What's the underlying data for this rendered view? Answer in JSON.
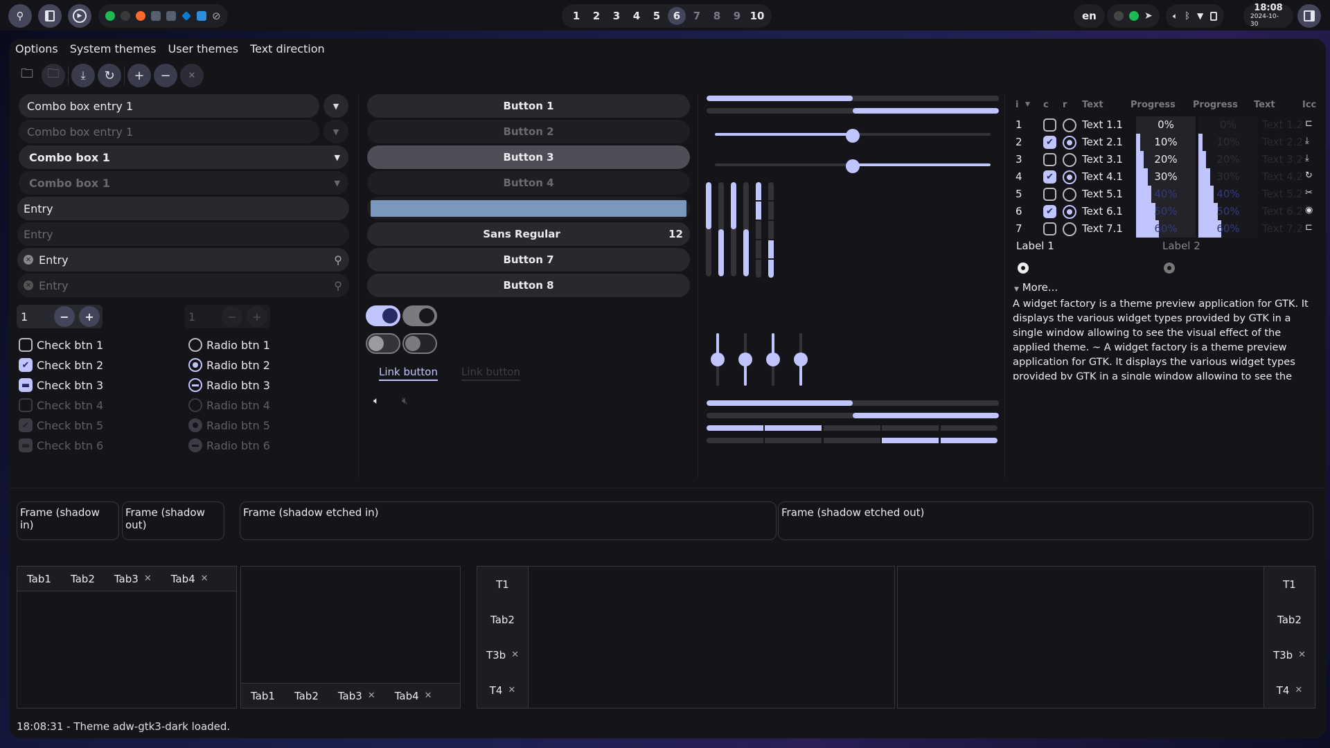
{
  "topbar": {
    "workspaces": [
      {
        "label": "1",
        "state": "normal"
      },
      {
        "label": "2",
        "state": "normal"
      },
      {
        "label": "3",
        "state": "normal"
      },
      {
        "label": "4",
        "state": "normal"
      },
      {
        "label": "5",
        "state": "normal"
      },
      {
        "label": "6",
        "state": "active"
      },
      {
        "label": "7",
        "state": "dim"
      },
      {
        "label": "8",
        "state": "dim"
      },
      {
        "label": "9",
        "state": "dim"
      },
      {
        "label": "10",
        "state": "normal"
      }
    ],
    "apps": [
      "spotify-icon",
      "obs-icon",
      "firefox-icon",
      "folder-icon",
      "folder-icon",
      "vscode-icon",
      "files-icon",
      "blocked-icon"
    ],
    "language": "en",
    "clock_time": "18:08",
    "clock_date": "2024-10-30"
  },
  "menu": [
    "Options",
    "System themes",
    "User themes",
    "Text direction"
  ],
  "col1": {
    "combo_entry": "Combo box entry 1",
    "combo_entry_disabled": "Combo box entry 1",
    "combo": "Combo box 1",
    "combo_disabled": "Combo box 1",
    "entry": "Entry",
    "entry_disabled": "Entry",
    "search_entry": "Entry",
    "search_entry_disabled": "Entry",
    "spin_value": "1",
    "spin_value_disabled": "1",
    "spin_minus": "−",
    "spin_plus": "+",
    "checks": [
      {
        "label": "Check btn 1",
        "state": "off"
      },
      {
        "label": "Check btn 2",
        "state": "on"
      },
      {
        "label": "Check btn 3",
        "state": "mixed"
      },
      {
        "label": "Check btn 4",
        "state": "dis"
      },
      {
        "label": "Check btn 5",
        "state": "dison"
      },
      {
        "label": "Check btn 6",
        "state": "dismix"
      }
    ],
    "radios": [
      {
        "label": "Radio btn 1",
        "state": "off"
      },
      {
        "label": "Radio btn 2",
        "state": "on"
      },
      {
        "label": "Radio btn 3",
        "state": "mix"
      },
      {
        "label": "Radio btn 4",
        "state": "dis"
      },
      {
        "label": "Radio btn 5",
        "state": "dison"
      },
      {
        "label": "Radio btn 6",
        "state": "dismix"
      }
    ]
  },
  "col2": {
    "buttons": [
      "Button 1",
      "Button 2",
      "Button 3",
      "Button 4"
    ],
    "font_button": "Sans Regular",
    "font_size": "12",
    "button7": "Button 7",
    "button8": "Button 8",
    "color_button": "#7a98bd",
    "link": "Link button",
    "link_disabled": "Link button"
  },
  "col3": {
    "hprogress": [
      0.5,
      0.5
    ],
    "hscale": [
      0.5,
      0.5
    ],
    "vprogress": [
      0.5,
      0.5,
      0.5,
      0.5
    ],
    "level_bars": [
      0.4,
      0.4
    ],
    "vscale": [
      0.5,
      0.5,
      0.5,
      0.5
    ],
    "hprogress2": [
      0.5,
      0.5
    ],
    "hlevel": [
      0.4,
      0.4
    ]
  },
  "col4": {
    "headers": [
      "i",
      "c",
      "r",
      "Text",
      "Progress",
      "Progress",
      "Text",
      "Icc"
    ],
    "rows": [
      {
        "i": "1",
        "c": false,
        "r": false,
        "t1": "Text 1.1",
        "p": 0,
        "pl": "0%",
        "t2": "Text 1.2"
      },
      {
        "i": "2",
        "c": true,
        "r": true,
        "t1": "Text 2.1",
        "p": 10,
        "pl": "10%",
        "t2": "Text 2.2"
      },
      {
        "i": "3",
        "c": false,
        "r": false,
        "t1": "Text 3.1",
        "p": 20,
        "pl": "20%",
        "t2": "Text 3.2"
      },
      {
        "i": "4",
        "c": true,
        "r": true,
        "t1": "Text 4.1",
        "p": 30,
        "pl": "30%",
        "t2": "Text 4.2"
      },
      {
        "i": "5",
        "c": false,
        "r": false,
        "t1": "Text 5.1",
        "p": 40,
        "pl": "40%",
        "t2": "Text 5.2"
      },
      {
        "i": "6",
        "c": true,
        "r": true,
        "t1": "Text 6.1",
        "p": 50,
        "pl": "50%",
        "t2": "Text 6.2"
      },
      {
        "i": "7",
        "c": false,
        "r": false,
        "t1": "Text 7.1",
        "p": 60,
        "pl": "60%",
        "t2": "Text 7.2"
      }
    ],
    "label1": "Label 1",
    "label2": "Label 2",
    "expander": "More...",
    "text": "A widget factory is a theme preview application for GTK. It displays the various widget types provided by GTK in a single window allowing to see the visual effect of the applied theme. ~ A widget factory is a theme preview application for GTK. It displays the various widget types provided by GTK in a single window allowing to see the visual effect of the applied theme."
  },
  "frames": [
    "Frame (shadow in)",
    "Frame (shadow out)",
    "Frame (shadow etched in)",
    "Frame (shadow etched out)"
  ],
  "notebooks": {
    "h_tabs": [
      {
        "label": "Tab1",
        "close": false
      },
      {
        "label": "Tab2",
        "close": false
      },
      {
        "label": "Tab3",
        "close": true
      },
      {
        "label": "Tab4",
        "close": true
      }
    ],
    "v_tabs": [
      {
        "label": "T1",
        "close": false
      },
      {
        "label": "Tab2",
        "close": false
      },
      {
        "label": "T3b",
        "close": true
      },
      {
        "label": "T4",
        "close": true
      }
    ]
  },
  "status": "18:08:31 - Theme adw-gtk3-dark loaded.",
  "colors": {
    "accent": "#c0c4ff",
    "window_bg": "#151519",
    "widget_bg": "#28282f"
  }
}
